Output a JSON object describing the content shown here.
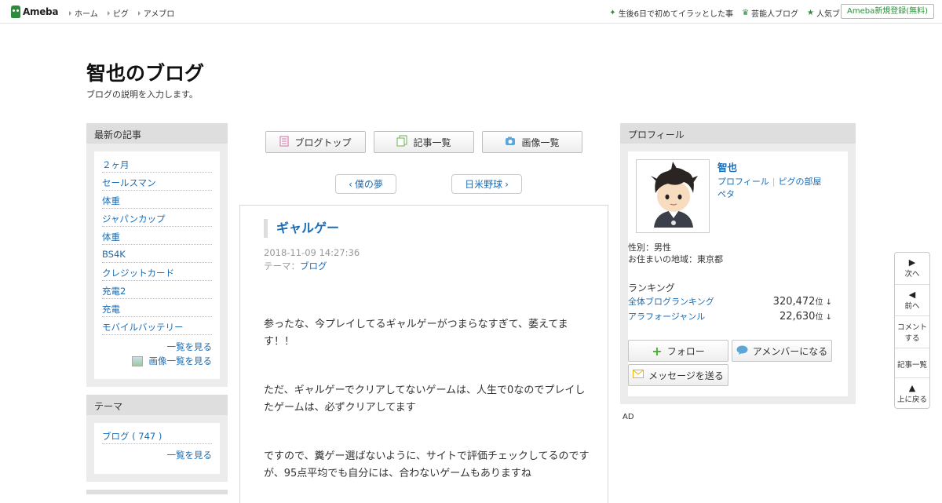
{
  "header": {
    "logo": "Ameba",
    "nav": [
      "ホーム",
      "ピグ",
      "アメブロ"
    ],
    "right_links": [
      {
        "label": "生後6日で初めてイラッとした事",
        "icon": "sparkle-icon"
      },
      {
        "label": "芸能人ブログ",
        "icon": "crown-icon"
      },
      {
        "label": "人気ブログ",
        "icon": "star-icon"
      }
    ],
    "signup": "Ameba新規登録(無料)"
  },
  "blog": {
    "title": "智也のブログ",
    "description": "ブログの説明を入力します。"
  },
  "recent": {
    "heading": "最新の記事",
    "items": [
      "２ヶ月",
      "セールスマン",
      "体重",
      "ジャパンカップ",
      "体重",
      "BS4K",
      "クレジットカード",
      "充電2",
      "充電",
      "モバイルバッテリー"
    ],
    "more": "一覧を見る",
    "image_more": "画像一覧を見る"
  },
  "theme": {
    "heading": "テーマ",
    "item": "ブログ ( 747 )",
    "more": "一覧を見る"
  },
  "center_nav": {
    "blog_top": "ブログトップ",
    "entry_list": "記事一覧",
    "image_list": "画像一覧",
    "prev": "僕の夢",
    "next": "日米野球"
  },
  "article": {
    "title": "ギャルゲー",
    "date": "2018-11-09 14:27:36",
    "theme_label": "テーマ：",
    "theme": "ブログ",
    "paragraphs": [
      "参ったな、今プレイしてるギャルゲーがつまらなすぎて、萎えてます！！",
      "ただ、ギャルゲーでクリアしてないゲームは、人生で0なのでプレイしたゲームは、必ずクリアしてます",
      "ですので、糞ゲー選ばないように、サイトで評価チェックしてるのですが、95点平均でも自分には、合わないゲームもありますね"
    ]
  },
  "profile": {
    "heading": "プロフィール",
    "name": "智也",
    "link_profile": "プロフィール",
    "link_room": "ピグの部屋",
    "link_peta": "ペタ",
    "gender": "性別：男性",
    "location": "お住まいの地域：東京都",
    "ranking_heading": "ランキング",
    "ranks": [
      {
        "label": "全体ブログランキング",
        "value": "320,472",
        "unit": "位 ↓"
      },
      {
        "label": "アラフォージャンル",
        "value": "22,630",
        "unit": "位 ↓"
      }
    ],
    "follow": "フォロー",
    "amember": "アメンバーになる",
    "message": "メッセージを送る"
  },
  "ad_label": "AD",
  "float_nav": {
    "next": "次へ",
    "prev": "前へ",
    "comment": "コメントする",
    "list": "記事一覧",
    "top": "上に戻る"
  },
  "colors": {
    "link": "#1a6cb5",
    "brand": "#2d8c3c"
  }
}
